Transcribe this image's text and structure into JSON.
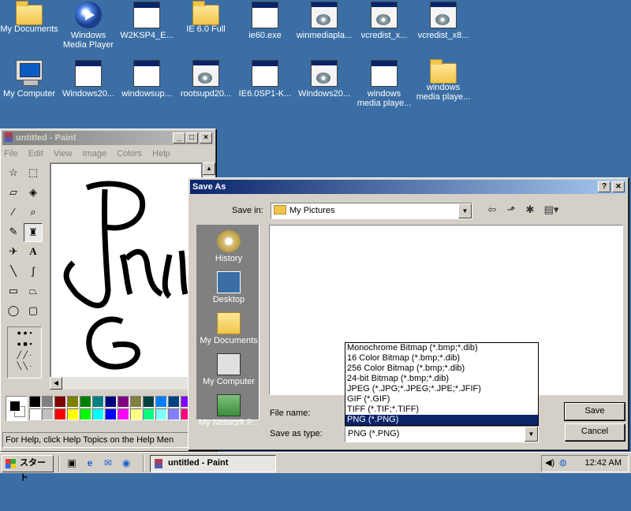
{
  "desktop": {
    "icons": [
      {
        "label": "My Documents",
        "icon": "folder-docs-icon"
      },
      {
        "label": "Windows\nMedia Player",
        "icon": "media-player-icon"
      },
      {
        "label": "W2KSP4_E...",
        "icon": "program-window-icon"
      },
      {
        "label": "IE 6.0 Full",
        "icon": "folder-icon"
      },
      {
        "label": "ie60.exe",
        "icon": "program-window-icon"
      },
      {
        "label": "winmediapla...",
        "icon": "setup-icon"
      },
      {
        "label": "vcredist_x...",
        "icon": "setup-icon"
      },
      {
        "label": "vcredist_x8...",
        "icon": "setup-icon"
      },
      {
        "label": "My Computer",
        "icon": "computer-icon"
      },
      {
        "label": "Windows20...",
        "icon": "program-window-icon"
      },
      {
        "label": "windowsup...",
        "icon": "program-window-icon"
      },
      {
        "label": "rootsupd20...",
        "icon": "setup-icon"
      },
      {
        "label": "IE6.0SP1-K...",
        "icon": "program-window-icon"
      },
      {
        "label": "Windows20...",
        "icon": "setup-icon"
      },
      {
        "label": "windows\nmedia playe...",
        "icon": "program-window-icon"
      },
      {
        "label": "windows\nmedia playe...",
        "icon": "folder-icon"
      }
    ]
  },
  "paint": {
    "title": "untitled - Paint",
    "menu": [
      "File",
      "Edit",
      "View",
      "Image",
      "Colors",
      "Help"
    ],
    "status": "For Help, click Help Topics on the Help Men",
    "canvas_text": "PNG",
    "palette": [
      "#000000",
      "#808080",
      "#800000",
      "#808000",
      "#008000",
      "#008080",
      "#000080",
      "#800080",
      "#808040",
      "#004040",
      "#0080ff",
      "#004080",
      "#8000ff",
      "#804000",
      "#ffffff",
      "#c0c0c0",
      "#ff0000",
      "#ffff00",
      "#00ff00",
      "#00ffff",
      "#0000ff",
      "#ff00ff",
      "#ffff80",
      "#00ff80",
      "#80ffff",
      "#8080ff",
      "#ff0080",
      "#ff8040"
    ]
  },
  "saveas": {
    "title": "Save As",
    "help_btn": "?",
    "close_btn": "✕",
    "save_in_label": "Save in:",
    "save_in_value": "My Pictures",
    "places": [
      "History",
      "Desktop",
      "My Documents",
      "My Computer",
      "My Network P..."
    ],
    "file_name_label": "File name:",
    "file_name_value": "",
    "save_as_type_label": "Save as type:",
    "save_as_type_value": "PNG (*.PNG)",
    "type_options": [
      "Monochrome Bitmap (*.bmp;*.dib)",
      "16 Color Bitmap (*.bmp;*.dib)",
      "256 Color Bitmap (*.bmp;*.dib)",
      "24-bit Bitmap (*.bmp;*.dib)",
      "JPEG (*.JPG;*.JPEG;*.JPE;*.JFIF)",
      "GIF (*.GIF)",
      "TIFF (*.TIF;*.TIFF)",
      "PNG (*.PNG)"
    ],
    "selected_type_index": 7,
    "save_button": "Save",
    "cancel_button": "Cancel"
  },
  "taskbar": {
    "start": "スタート",
    "task": "untitled - Paint",
    "clock": "12:42 AM"
  }
}
